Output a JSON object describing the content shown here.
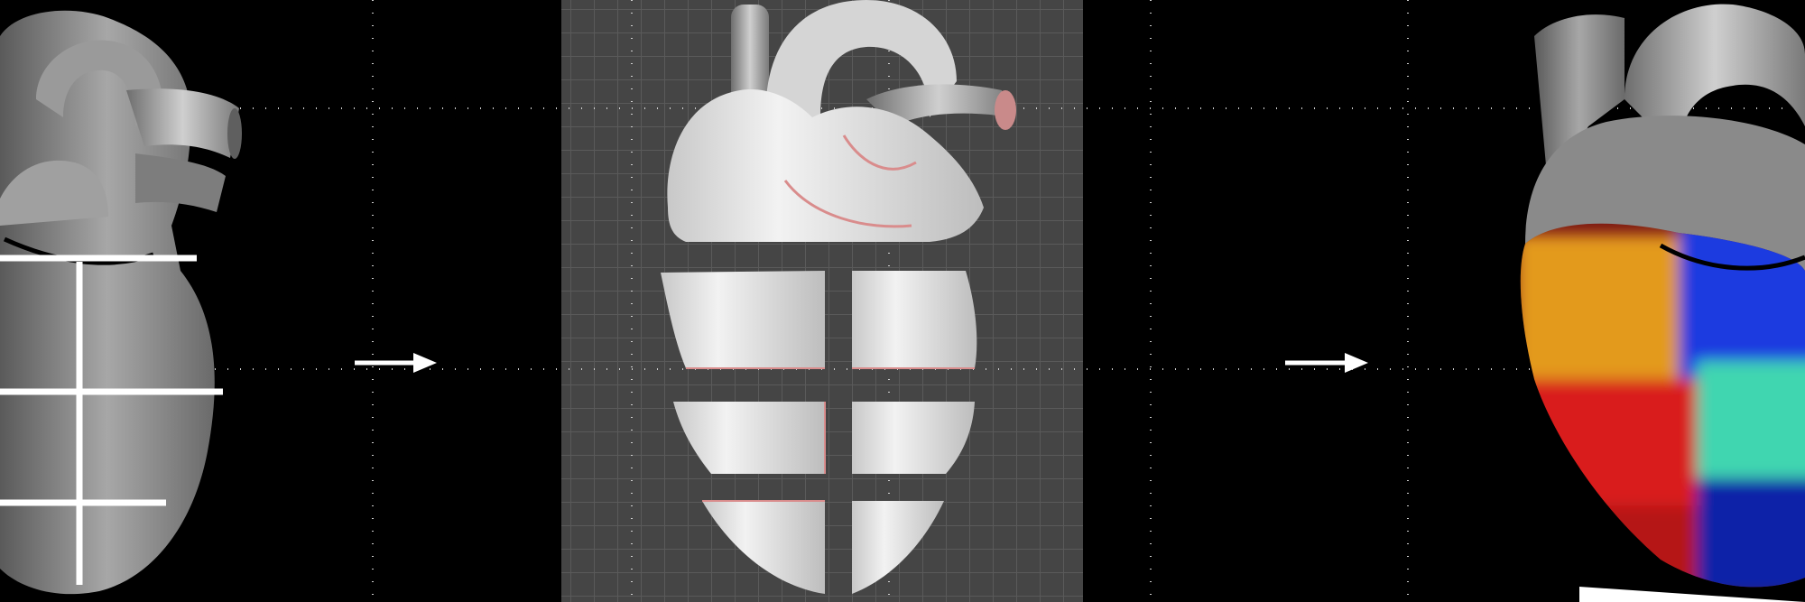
{
  "scene": {
    "panels": [
      {
        "id": "left",
        "subject": "heart-model-with-cut-lines"
      },
      {
        "id": "center",
        "subject": "heart-model-segmented-slices"
      },
      {
        "id": "right",
        "subject": "heart-model-color-mapped"
      }
    ],
    "arrows": [
      {
        "id": "arrow-1",
        "direction": "right"
      },
      {
        "id": "arrow-2",
        "direction": "right"
      }
    ],
    "colors": {
      "background": "#000000",
      "grid_panel": "#454545",
      "grid_line": "#5a5a5a",
      "heart_gray": "#8c8c8c",
      "segment_orange": "#e39a1a",
      "segment_blue": "#1f3be0",
      "segment_red": "#d91c1c",
      "segment_teal": "#3fd6b0",
      "segment_navy": "#0c22a8"
    }
  }
}
